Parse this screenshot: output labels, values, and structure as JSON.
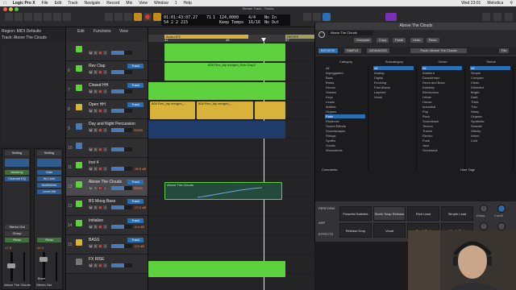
{
  "menubar": {
    "app": "Logic Pro X",
    "items": [
      "File",
      "Edit",
      "Track",
      "Navigate",
      "Record",
      "Mix",
      "View",
      "Window",
      "1",
      "Help"
    ],
    "clock": "Wed 23:01",
    "user": "Melodica"
  },
  "window_title": "Stream Track - Tracks",
  "lcd": {
    "position": "01:01:43:07.27",
    "bars": "54  2  2  215",
    "bar": "71",
    "beat": "1",
    "tempo": "124,0000",
    "tempo_label": "Keep Tempo",
    "sig": "4/4",
    "sig2": "16/16",
    "in": "No In",
    "out": "No Out"
  },
  "inspector": {
    "region": "Region: MIDI Defaults",
    "track": "Track: Above The Clouds",
    "setting_left": "Setting",
    "setting_right": "Setting",
    "slots": [
      "Alchemy",
      "Channel EQ"
    ],
    "sends": [
      "Gain",
      "Ad Limit",
      "MultiMeter",
      "Level Mtr"
    ],
    "out_left": "Stereo Out",
    "out_right": "Stereo Out",
    "group": "Group",
    "read": "Read",
    "vol_left": "-17,8",
    "vol_right": "-30,4",
    "name_left": "Above The Clouds",
    "name_right": "Stereo Out",
    "m": "M",
    "s": "S",
    "bnc": "Bnce"
  },
  "tracks_toolbar": {
    "edit": "Edit",
    "functions": "Functions",
    "view": "View"
  },
  "tracks": [
    {
      "num": "",
      "name": "",
      "vol": "",
      "mode": ""
    },
    {
      "num": "6",
      "name": "Rev Clap",
      "vol": "",
      "mode": "Track"
    },
    {
      "num": "7",
      "name": "Closed HH",
      "vol": "",
      "mode": "Track"
    },
    {
      "num": "8",
      "name": "Open HH",
      "vol": "",
      "mode": "Track"
    },
    {
      "num": "9",
      "name": "Day and Night Percussion",
      "vol": "20000",
      "mode": ""
    },
    {
      "num": "10",
      "name": "",
      "vol": "",
      "mode": ""
    },
    {
      "num": "11",
      "name": "Inst 4",
      "vol": "-38,5 dB",
      "mode": ""
    },
    {
      "num": "12",
      "name": "Above The Clouds",
      "vol": "20000",
      "mode": "Track"
    },
    {
      "num": "13",
      "name": "BS Moog Bass",
      "vol": "-27,0 dB",
      "mode": "Track"
    },
    {
      "num": "14",
      "name": "Initialize",
      "vol": "-4,4 dB",
      "mode": "Track"
    },
    {
      "num": "15",
      "name": "BASS",
      "vol": "-5,0 dB",
      "mode": "Track"
    },
    {
      "num": "",
      "name": "FX RISE",
      "vol": "",
      "mode": ""
    }
  ],
  "ruler": {
    "bar_left": "41",
    "bar_mid": "49",
    "bar_right": "57",
    "marker_build": "Build-UP2",
    "marker_drop": "DROPS"
  },
  "regions": {
    "clap": "808 Flex_bip merged_Kick Clap2",
    "hh": "808 Flex_bip merged_...",
    "above": "Above The Clouds"
  },
  "plugin": {
    "title": "Above The Clouds",
    "preset": "Above The Clouds",
    "compare": "Compare",
    "copy": "Copy",
    "paste": "Paste",
    "undo": "Undo",
    "redo": "Redo",
    "tabs": [
      "BROWSE",
      "SIMPLE",
      "ADVANCED"
    ],
    "path": "Pads / Above The Clouds",
    "file": "File",
    "columns": {
      "category": {
        "label": "Category",
        "items": [
          "All",
          "Arpeggiated",
          "Bass",
          "Brass",
          "Drums",
          "Guitars",
          "Keys",
          "Leads",
          "Mallets",
          "Organs",
          "Pads",
          "Rhythmic",
          "Sound Effects",
          "Soundscapes",
          "Strings",
          "Synths",
          "Vocals",
          "Woodwinds"
        ],
        "selected": 10
      },
      "subcategory": {
        "label": "Subcategory",
        "items": [
          "All",
          "Analog",
          "Digital",
          "Evolving",
          "Fast Attack",
          "Layered",
          "Vocal"
        ],
        "selected": 0
      },
      "genre": {
        "label": "Genre",
        "items": [
          "All",
          "Ambient",
          "Downtempo",
          "Drum and Bass",
          "Dubstep",
          "Electronica",
          "Urban",
          "House",
          "Industrial",
          "Pop",
          "Rock",
          "Soundtrack",
          "Techno",
          "Trance",
          "Electro",
          "Funk",
          "Jazz",
          "Orchestral"
        ],
        "selected": 0
      },
      "timbre": {
        "label": "Timbre",
        "items": [
          "All",
          "Simple",
          "Complex",
          "Clean",
          "Distorted",
          "Bright",
          "Dark",
          "Thick",
          "Thin",
          "Nasty",
          "Organic",
          "Synthetic",
          "Smooth",
          "Glitchy",
          "Warm",
          "Cold"
        ],
        "selected": 0
      }
    },
    "comments": "Comments",
    "user_tags": "User Tags",
    "perform": "PERFORM",
    "arp": "ARP",
    "effects": "EFFECTS",
    "pads": [
      "Peaceful Bubbles",
      "Sizzle Snap Release",
      "Rich Lead",
      "Simple Lead",
      "Release Drop",
      "Vocal",
      "Synth Pad",
      "Windy Slide"
    ],
    "knobs": [
      "Delay",
      "Cutoff",
      "Filter Sweep",
      "Volume"
    ],
    "off": "Off"
  }
}
